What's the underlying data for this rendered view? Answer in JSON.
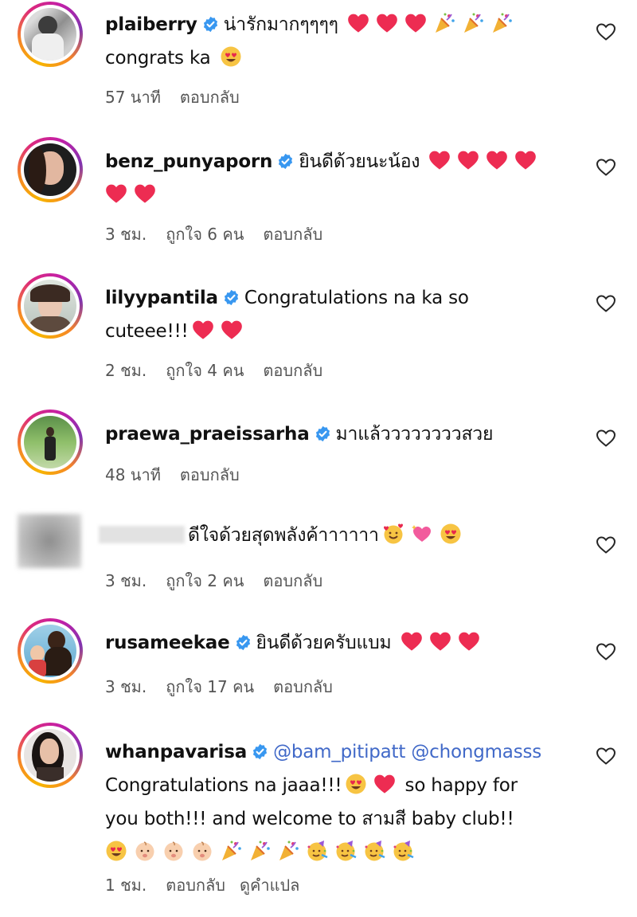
{
  "comments": [
    {
      "username": "plaiberry",
      "text": "น่ารักมากๆๆๆๆ",
      "text2": "congrats ka",
      "time": "57 นาที",
      "likes": "",
      "reply": "ตอบกลับ"
    },
    {
      "username": "benz_punyaporn",
      "text": "ยินดีด้วยนะน้อง",
      "time": "3 ชม.",
      "likes": "ถูกใจ 6 คน",
      "reply": "ตอบกลับ"
    },
    {
      "username": "lilyypantila",
      "text": "Congratulations na ka so",
      "text2": "cuteee!!!",
      "time": "2 ชม.",
      "likes": "ถูกใจ 4 คน",
      "reply": "ตอบกลับ"
    },
    {
      "username": "praewa_praeissarha",
      "text": "มาแล้ววววววววสวย",
      "time": "48 นาที",
      "likes": "",
      "reply": "ตอบกลับ"
    },
    {
      "username": "",
      "text": "ดีใจด้วยสุดพลังค้าาาาาา",
      "time": "3 ชม.",
      "likes": "ถูกใจ 2 คน",
      "reply": "ตอบกลับ"
    },
    {
      "username": "rusameekae",
      "text": "ยินดีด้วยครับแบม",
      "time": "3 ชม.",
      "likes": "ถูกใจ 17 คน",
      "reply": "ตอบกลับ"
    },
    {
      "username": "whanpavarisa",
      "mention1": "@bam_pitipatt",
      "mention2": "@chongmasss",
      "text": "Congratulations na jaaa!!!",
      "text2": "so happy for",
      "text3": "you both!!! and welcome to สามสี baby club!!",
      "time": "1 ชม.",
      "reply": "ตอบกลับ",
      "translate": "ดูคำแปล"
    }
  ],
  "icons": {
    "verified": "verified-badge-icon",
    "like": "heart-outline-icon"
  },
  "colors": {
    "verified": "#3897f0",
    "mention": "#4169c8",
    "heart": "#ed2c52"
  }
}
